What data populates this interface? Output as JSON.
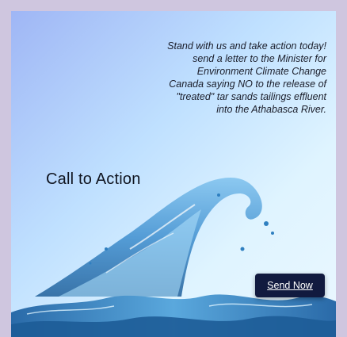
{
  "card": {
    "message": "Stand with us and take action today!\nsend a letter to the Minister for\nEnvironment Climate Change\nCanada saying NO to the release of\n\"treated\" tar sands tailings effluent\ninto the Athabasca River.",
    "heading": "Call to Action",
    "button_label": "Send Now"
  },
  "colors": {
    "page_background": "#cfc6df",
    "button_background": "#111a3f",
    "water": "#2f7fc0"
  },
  "icons": {
    "wave": "water-splash-image"
  }
}
